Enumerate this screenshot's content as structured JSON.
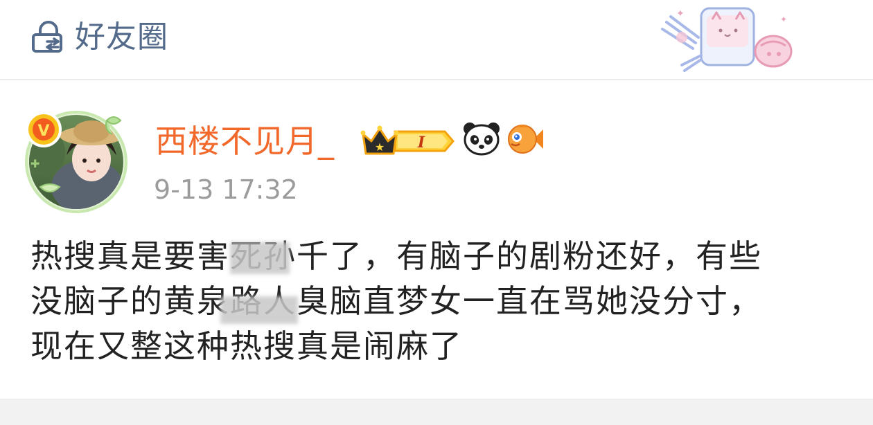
{
  "header": {
    "title": "好友圈",
    "icons": {
      "left": "lock-cloud-icon",
      "right": "cat-cake-sticker"
    }
  },
  "post": {
    "username": "西楼不见月_",
    "timestamp": "9-13 17:32",
    "badges": [
      "crown-level-badge",
      "panda-icon",
      "fish-icon",
      "verified-v-badge"
    ],
    "level_badge_text": "I",
    "verified_badge_text": "V",
    "text_lines": [
      "热搜真是要害死孙千了，有脑子的剧粉还好，有些",
      "没脑子的黄泉路人臭脑直梦女一直在骂她没分寸，",
      "现在又整这种热搜真是闹麻了"
    ]
  },
  "colors": {
    "username": "#f2682a",
    "header_text": "#546a8a",
    "timestamp": "#9b9b9b",
    "body_text": "#222222"
  }
}
